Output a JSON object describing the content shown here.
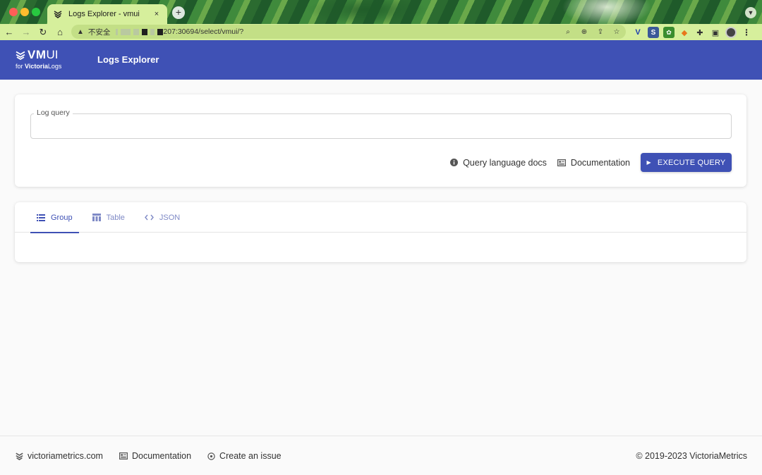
{
  "browser": {
    "tab_title": "Logs Explorer - vmui",
    "tab_close": "×",
    "new_tab": "+",
    "insecure_label": "不安全",
    "url_suffix": "207:30694/select/vmui/?"
  },
  "header": {
    "logo_vm": "VM",
    "logo_ui": "UI",
    "logo_for": "for ",
    "logo_brand_bold": "Victoria",
    "logo_brand_rest": "Logs",
    "title": "Logs Explorer",
    "color": "#3f51b5"
  },
  "query": {
    "label": "Log query",
    "value": "",
    "docs_link": "Query language docs",
    "documentation_link": "Documentation",
    "execute_button": "EXECUTE QUERY"
  },
  "results": {
    "tabs": [
      {
        "label": "Group",
        "icon": "list-icon",
        "active": true
      },
      {
        "label": "Table",
        "icon": "table-icon",
        "active": false
      },
      {
        "label": "JSON",
        "icon": "code-icon",
        "active": false
      }
    ]
  },
  "footer": {
    "links": [
      {
        "label": "victoriametrics.com",
        "icon": "victoriametrics-logo-icon"
      },
      {
        "label": "Documentation",
        "icon": "docs-icon"
      },
      {
        "label": "Create an issue",
        "icon": "issue-icon"
      }
    ],
    "copyright": "© 2019-2023 VictoriaMetrics"
  }
}
